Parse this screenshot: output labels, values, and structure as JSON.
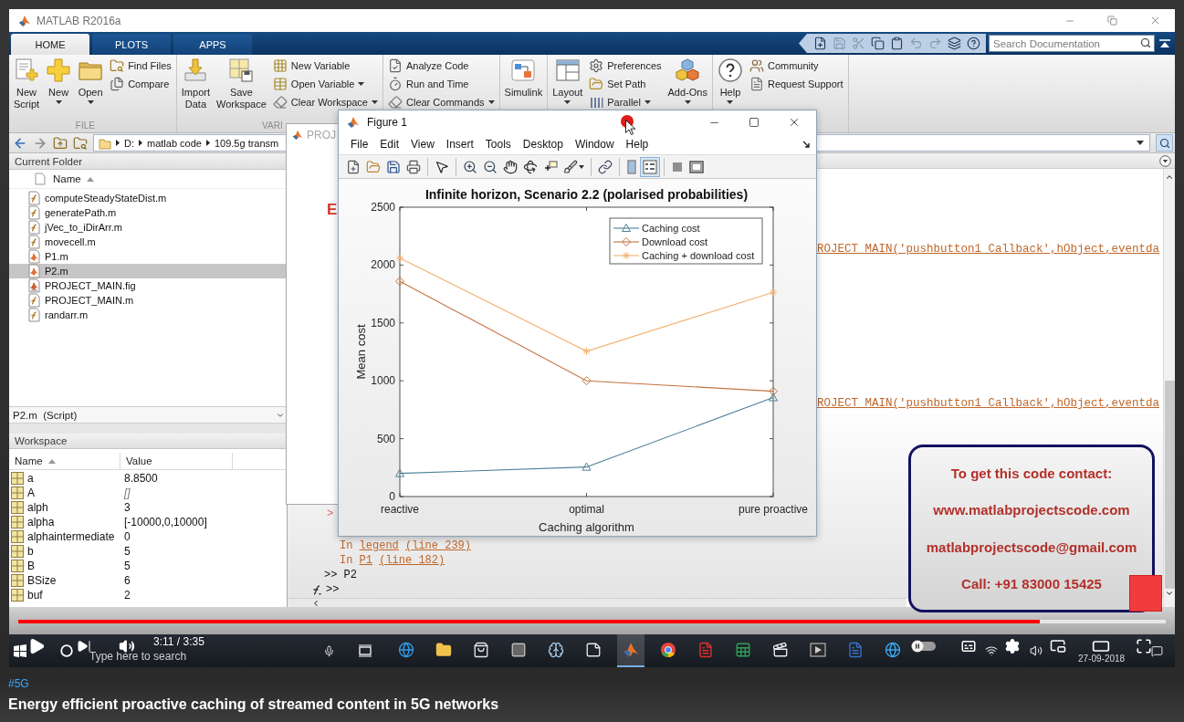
{
  "matlab": {
    "title": "MATLAB R2016a",
    "tabs": [
      {
        "label": "HOME",
        "selected": true
      },
      {
        "label": "PLOTS",
        "selected": false
      },
      {
        "label": "APPS",
        "selected": false
      }
    ],
    "quick_access": [
      {
        "disabled": false
      },
      {
        "disabled": true
      },
      {
        "disabled": true
      },
      {
        "disabled": false
      },
      {
        "disabled": false
      },
      {
        "disabled": true
      },
      {
        "disabled": true
      },
      {
        "disabled": false
      },
      {
        "disabled": false
      }
    ],
    "search": {
      "placeholder": "Search Documentation"
    },
    "toolstrip": [
      {
        "label": "FILE",
        "items": [
          {
            "kind": "large",
            "label": "New Script",
            "caret": false
          },
          {
            "kind": "large",
            "label": "New",
            "caret": true
          },
          {
            "kind": "large",
            "label": "Open",
            "caret": true
          },
          {
            "kind": "stack",
            "entries": [
              {
                "label": "Find Files",
                "caret": false
              },
              {
                "label": "Compare",
                "caret": false
              }
            ]
          }
        ]
      },
      {
        "label": "VARI",
        "items": [
          {
            "kind": "large",
            "label": "Import Data",
            "caret": false
          },
          {
            "kind": "large",
            "label": "Save Workspace",
            "caret": false
          },
          {
            "kind": "stack",
            "entries": [
              {
                "label": "New Variable",
                "caret": false
              },
              {
                "label": "Open Variable",
                "caret": true
              },
              {
                "label": "Clear Workspace",
                "caret": true
              }
            ]
          }
        ]
      },
      {
        "items": [
          {
            "kind": "stack",
            "entries": [
              {
                "label": "Analyze Code",
                "caret": false
              },
              {
                "label": "Run and Time",
                "caret": false
              },
              {
                "label": "Clear Commands",
                "caret": true
              }
            ]
          }
        ]
      },
      {
        "items": [
          {
            "kind": "large",
            "label": "Simulink",
            "caret": false
          }
        ]
      },
      {
        "items": [
          {
            "kind": "large",
            "label": "Layout",
            "caret": true
          },
          {
            "kind": "stack",
            "entries": [
              {
                "label": "Preferences",
                "caret": false
              },
              {
                "label": "Set Path",
                "caret": false
              },
              {
                "label": "Parallel",
                "caret": true
              }
            ]
          },
          {
            "kind": "large",
            "label": "Add-Ons",
            "caret": true
          }
        ]
      },
      {
        "items": [
          {
            "kind": "large",
            "label": "Help",
            "caret": true
          },
          {
            "kind": "stack",
            "entries": [
              {
                "label": "Community",
                "caret": false
              },
              {
                "label": "Request Support",
                "caret": false
              }
            ]
          }
        ]
      }
    ],
    "address": {
      "segments": [
        "D:",
        "matlab code",
        "109.5g transm"
      ]
    },
    "current_folder": {
      "title": "Current Folder",
      "column": "Name",
      "files": [
        {
          "name": "computeSteadyStateDist.m",
          "kind": "function",
          "selected": false
        },
        {
          "name": "generatePath.m",
          "kind": "function",
          "selected": false
        },
        {
          "name": "jVec_to_iDirArr.m",
          "kind": "function",
          "selected": false
        },
        {
          "name": "movecell.m",
          "kind": "function",
          "selected": false
        },
        {
          "name": "P1.m",
          "kind": "script",
          "selected": false
        },
        {
          "name": "P2.m",
          "kind": "script",
          "selected": true
        },
        {
          "name": "PROJECT_MAIN.fig",
          "kind": "figure",
          "selected": false
        },
        {
          "name": "PROJECT_MAIN.m",
          "kind": "function",
          "selected": false
        },
        {
          "name": "randarr.m",
          "kind": "function",
          "selected": false
        }
      ]
    },
    "details": {
      "text": "P2.m  (Script)"
    },
    "workspace": {
      "title": "Workspace",
      "columns": [
        "Name",
        "Value"
      ],
      "rows": [
        {
          "name": "a",
          "value": "8.8500",
          "kind": "value"
        },
        {
          "name": "A",
          "value": "[]",
          "kind": "empty"
        },
        {
          "name": "alph",
          "value": "3",
          "kind": "value"
        },
        {
          "name": "alpha",
          "value": "[-10000,0,10000]",
          "kind": "value"
        },
        {
          "name": "alphaintermediate",
          "value": "0",
          "kind": "value"
        },
        {
          "name": "b",
          "value": "5",
          "kind": "value"
        },
        {
          "name": "B",
          "value": "5",
          "kind": "value"
        },
        {
          "name": "BSize",
          "value": "6",
          "kind": "value"
        },
        {
          "name": "buf",
          "value": "2",
          "kind": "value"
        }
      ]
    },
    "command_window": {
      "link_lines": [
        "ROJECT_MAIN('pushbutton1_Callback',hObject,eventda",
        "ROJECT_MAIN('pushbutton1_Callback',hObject,eventda"
      ],
      "marker": ">",
      "trace": [
        {
          "parts": [
            {
              "text": "In",
              "link": false
            },
            {
              "text": "legend",
              "link": true
            },
            {
              "text": "(line 239)",
              "link": true
            }
          ]
        },
        {
          "parts": [
            {
              "text": "In",
              "link": false
            },
            {
              "text": "P1",
              "link": true
            },
            {
              "text": "(line 182)",
              "link": true
            }
          ]
        }
      ],
      "history": [
        ">> P2"
      ],
      "prompt": ">>"
    }
  },
  "proj_window": {
    "title": "PROJ",
    "text": "E"
  },
  "figure": {
    "title": "Figure 1",
    "menu": [
      "File",
      "Edit",
      "View",
      "Insert",
      "Tools",
      "Desktop",
      "Window",
      "Help"
    ],
    "toolbar": [
      {
        "pressed": false
      },
      {
        "pressed": false
      },
      {
        "pressed": false
      },
      {
        "pressed": false
      },
      {
        "pressed": false
      },
      {
        "pressed": false
      },
      {
        "pressed": false
      },
      {
        "pressed": false
      },
      {
        "pressed": false
      },
      {
        "pressed": false
      },
      {
        "pressed": false
      },
      {
        "pressed": false
      },
      {
        "pressed": false
      },
      {
        "pressed": true
      },
      {
        "pressed": false
      },
      {
        "pressed": false
      }
    ],
    "chart_data": {
      "type": "line",
      "title": "Infinite horizon, Scenario 2.2 (polarised probabilities)",
      "xlabel": "Caching algorithm",
      "ylabel": "Mean cost",
      "categories": [
        "reactive",
        "optimal",
        "pure proactive"
      ],
      "series": [
        {
          "name": "Caching cost",
          "color": "#4f8099",
          "marker": "triangle",
          "values": [
            200,
            255,
            855
          ]
        },
        {
          "name": "Download cost",
          "color": "#c4743f",
          "marker": "diamond",
          "values": [
            1860,
            1000,
            910
          ]
        },
        {
          "name": "Caching + download cost",
          "color": "#f2b272",
          "marker": "cross",
          "values": [
            2060,
            1255,
            1765
          ]
        }
      ],
      "ylim": [
        0,
        2500
      ],
      "yticks": [
        {
          "value": 0,
          "label": "0"
        },
        500,
        1000,
        1500,
        2000,
        2500
      ],
      "legend": "upper right"
    }
  },
  "contact": {
    "lines": [
      "To get this code contact:",
      "www.matlabprojectscode.com",
      "matlabprojectscode@gmail.com",
      "Call: +91 83000 15425"
    ]
  },
  "taskbar": {
    "search": {
      "placeholder": "Type here to search"
    },
    "apps": [
      {
        "active": false
      },
      {
        "active": false
      },
      {
        "active": false
      },
      {
        "active": false
      },
      {
        "active": false
      },
      {
        "active": false
      },
      {
        "active": true
      },
      {
        "active": false
      },
      {
        "active": false
      },
      {
        "active": false
      },
      {
        "active": false
      },
      {
        "active": false
      },
      {
        "active": false
      },
      {
        "active": false
      }
    ],
    "date": "27-09-2018"
  },
  "player": {
    "progress": {
      "level": 0.89
    },
    "time": "3:11 / 3:35",
    "autoplay": {
      "on": false
    }
  },
  "video_info": {
    "hashtag": "#5G",
    "title": "Energy efficient proactive caching of streamed content in 5G networks"
  }
}
